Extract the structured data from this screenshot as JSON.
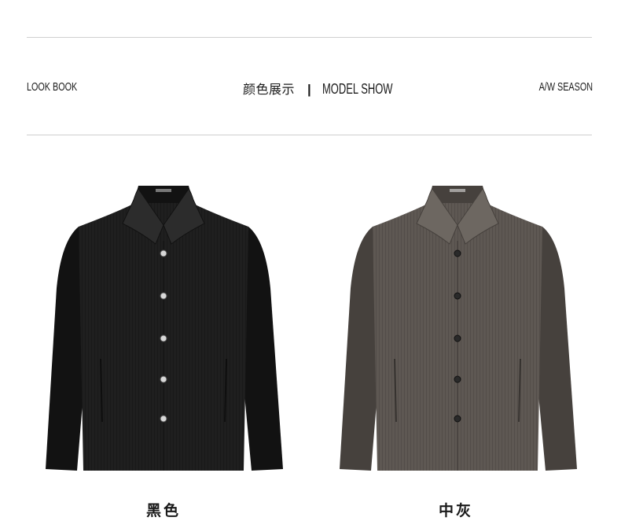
{
  "header": {
    "left_label": "LOOK BOOK",
    "center_cn": "颜色展示",
    "separator": "|",
    "center_en": "MODEL SHOW",
    "right_label": "A/W SEASON"
  },
  "products": [
    {
      "caption": "黑色",
      "color": "#1f1f1f",
      "shade": "#121212",
      "highlight": "#2c2c2c"
    },
    {
      "caption": "中灰",
      "color": "#5e5853",
      "shade": "#46413d",
      "highlight": "#6d6761"
    }
  ]
}
